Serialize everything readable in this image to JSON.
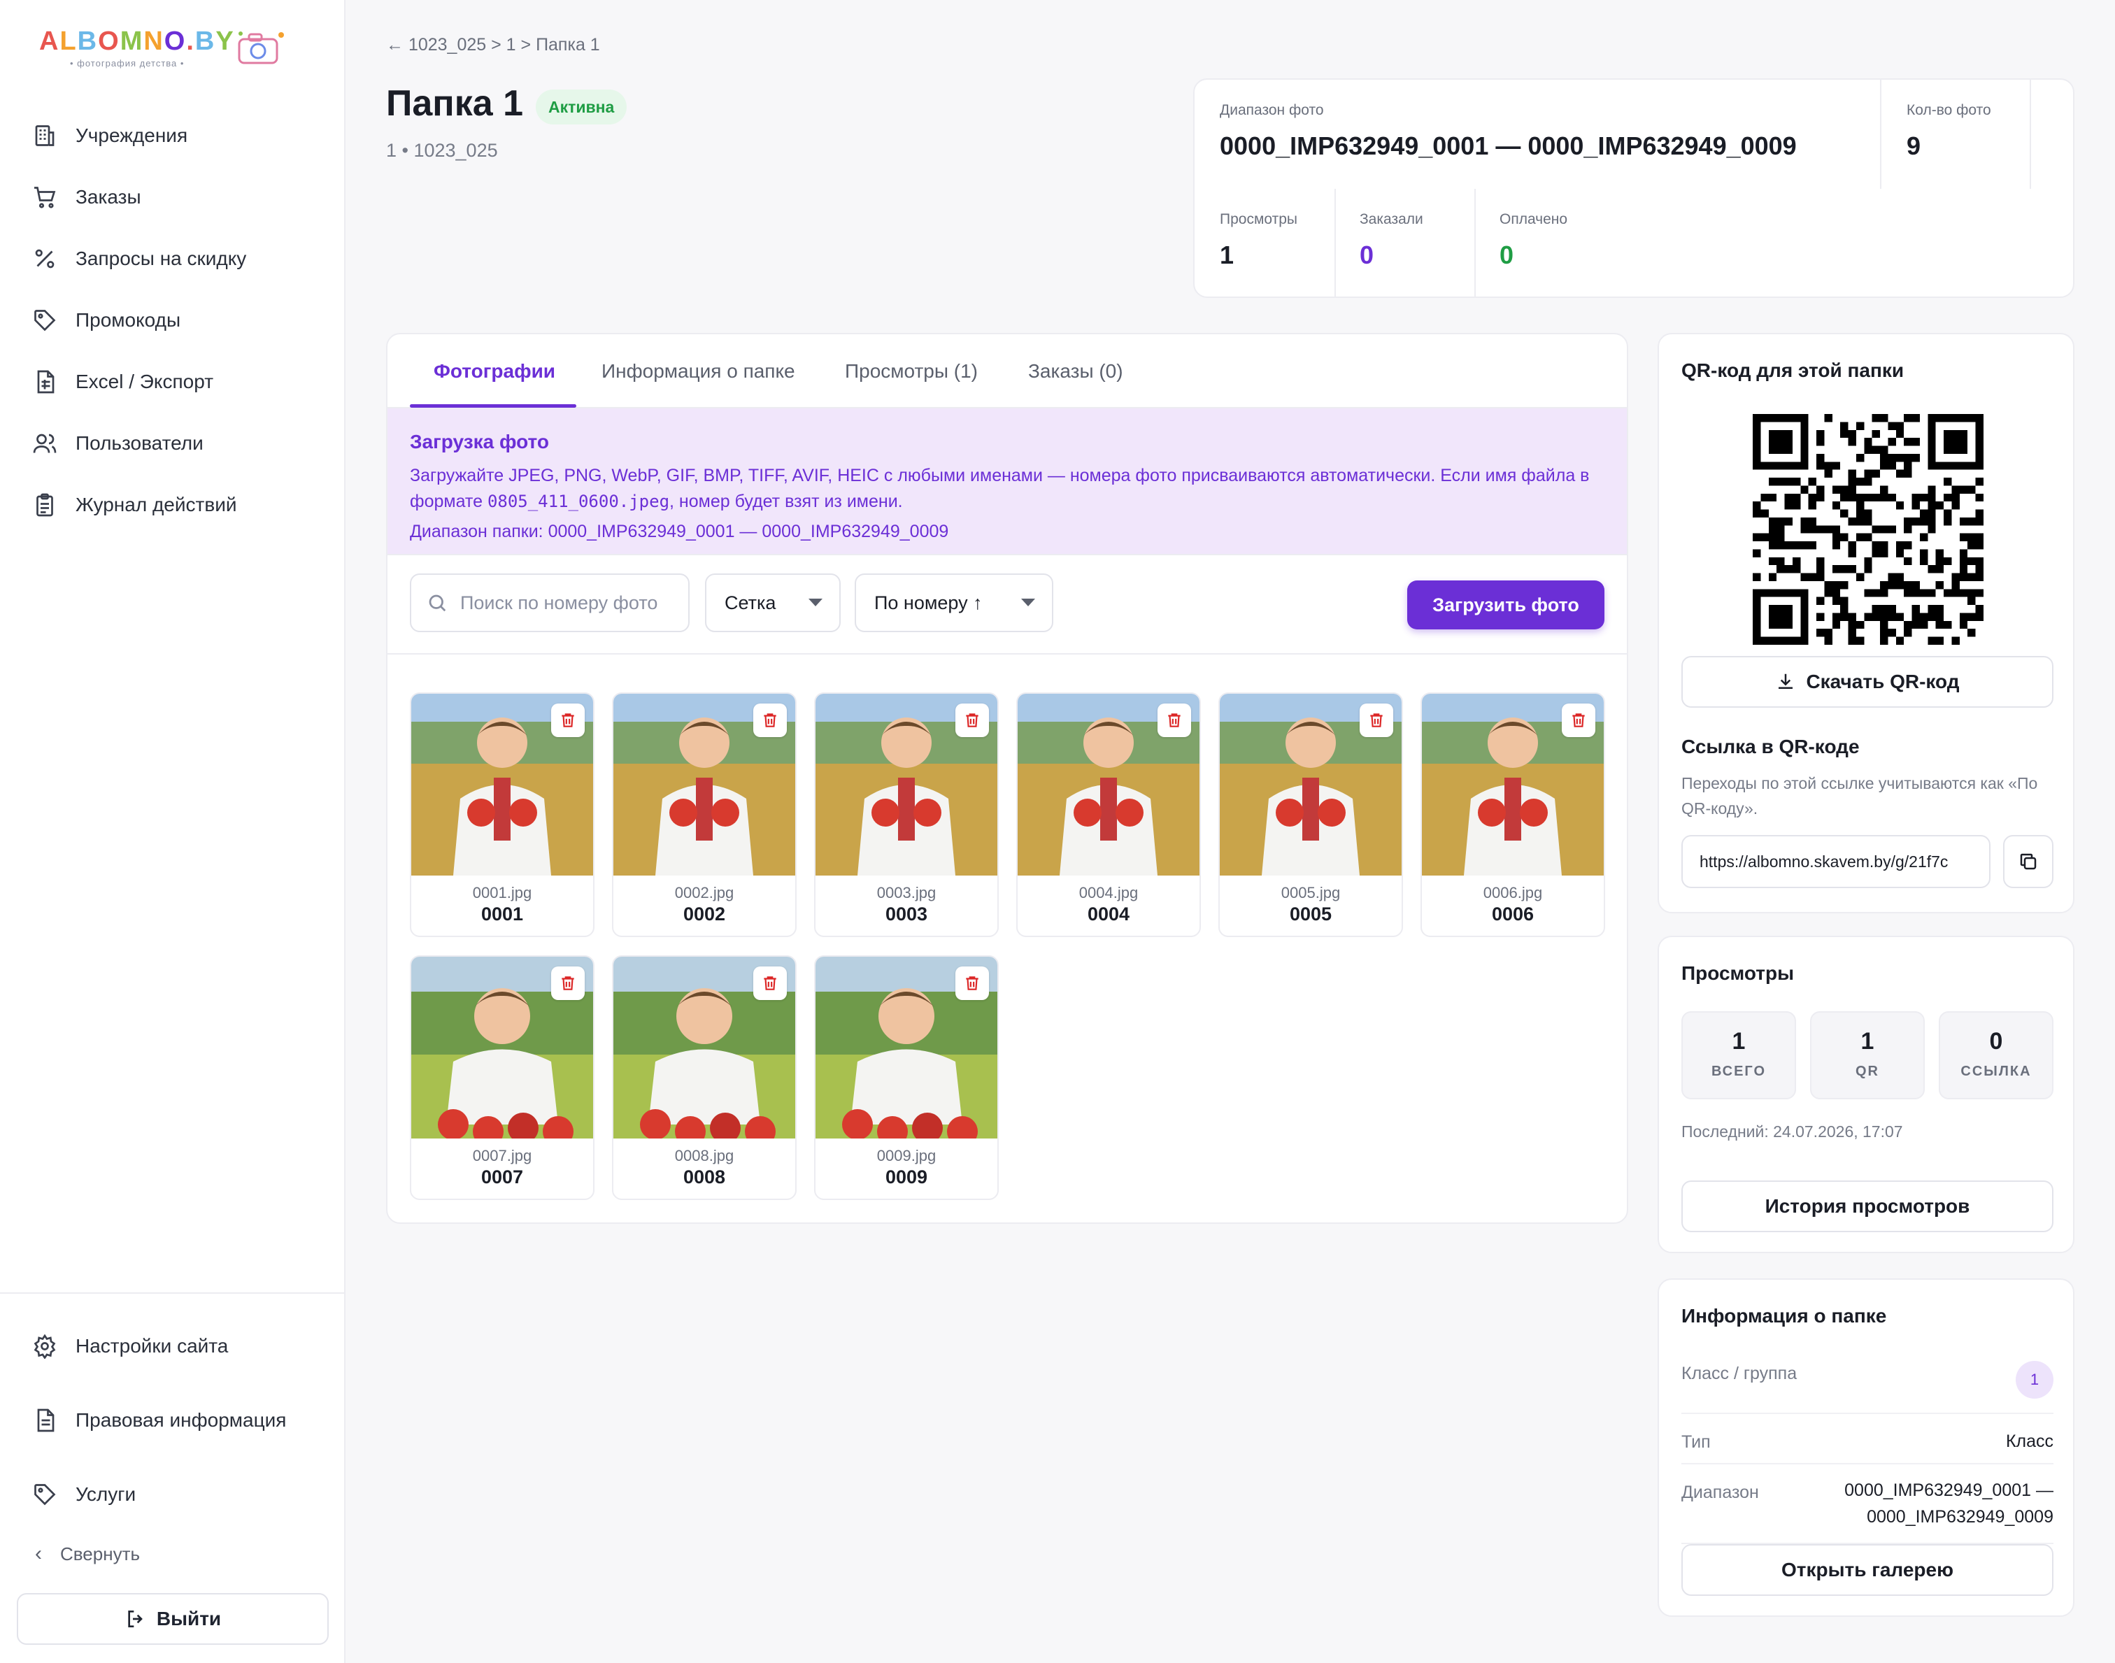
{
  "logo": {
    "text": "ALBOMNO.BY",
    "subtitle": "• фотография детства •"
  },
  "sidebar": {
    "items": [
      {
        "label": "Учреждения",
        "icon": "building-icon"
      },
      {
        "label": "Заказы",
        "icon": "cart-icon"
      },
      {
        "label": "Запросы на скидку",
        "icon": "percent-icon"
      },
      {
        "label": "Промокоды",
        "icon": "tag-icon"
      },
      {
        "label": "Excel / Экспорт",
        "icon": "spreadsheet-icon"
      },
      {
        "label": "Пользователи",
        "icon": "users-icon"
      },
      {
        "label": "Журнал действий",
        "icon": "clipboard-icon"
      }
    ],
    "bottom_items": [
      {
        "label": "Настройки сайта",
        "icon": "gear-icon"
      },
      {
        "label": "Правовая информация",
        "icon": "document-icon"
      },
      {
        "label": "Услуги",
        "icon": "tag-icon"
      }
    ],
    "collapse_label": "Свернуть",
    "logout_label": "Выйти"
  },
  "header": {
    "breadcrumb": "← 1023_025 > 1 > Папка 1",
    "title": "Папка 1",
    "status": "Активна",
    "subtitle": "1 • 1023_025"
  },
  "stats": {
    "range_label": "Диапазон фото",
    "range_value": "0000_IMP632949_0001 — 0000_IMP632949_0009",
    "count_label": "Кол-во фото",
    "count_value": "9",
    "views_label": "Просмотры",
    "views_value": "1",
    "ordered_label": "Заказали",
    "ordered_value": "0",
    "paid_label": "Оплачено",
    "paid_value": "0"
  },
  "tabs": [
    {
      "label": "Фотографии",
      "active": true
    },
    {
      "label": "Информация о папке",
      "active": false
    },
    {
      "label": "Просмотры (1)",
      "active": false
    },
    {
      "label": "Заказы (0)",
      "active": false
    }
  ],
  "upload_info": {
    "title": "Загрузка фото",
    "text_before": "Загружайте JPEG, PNG, WebP, GIF, BMP, TIFF, AVIF, HEIC с любыми именами — номера фото присваиваются автоматически. Если имя файла в формате ",
    "code": "0805_411_0600.jpeg",
    "text_after": ", номер будет взят из имени.",
    "range": "Диапазон папки: 0000_IMP632949_0001 — 0000_IMP632949_0009"
  },
  "toolbar": {
    "search_placeholder": "Поиск по номеру фото",
    "view_select": "Сетка",
    "sort_select": "По номеру ↑",
    "upload_label": "Загрузить фото"
  },
  "photos": [
    {
      "file": "0001.jpg",
      "num": "0001"
    },
    {
      "file": "0002.jpg",
      "num": "0002"
    },
    {
      "file": "0003.jpg",
      "num": "0003"
    },
    {
      "file": "0004.jpg",
      "num": "0004"
    },
    {
      "file": "0005.jpg",
      "num": "0005"
    },
    {
      "file": "0006.jpg",
      "num": "0006"
    },
    {
      "file": "0007.jpg",
      "num": "0007"
    },
    {
      "file": "0008.jpg",
      "num": "0008"
    },
    {
      "file": "0009.jpg",
      "num": "0009"
    }
  ],
  "qr_card": {
    "title": "QR-код для этой папки",
    "download_label": "Скачать QR-код",
    "link_title": "Ссылка в QR-коде",
    "link_note": "Переходы по этой ссылке учитываются как «По QR-коду».",
    "link_value": "https://albomno.skavem.by/g/21f7c"
  },
  "views_card": {
    "title": "Просмотры",
    "total": "1",
    "total_label": "ВСЕГО",
    "qr": "1",
    "qr_label": "QR",
    "link": "0",
    "link_label": "ССЫЛКА",
    "last": "Последний: 24.07.2026, 17:07",
    "history_label": "История просмотров"
  },
  "folder_info": {
    "title": "Информация о папке",
    "class_label": "Класс / группа",
    "class_value": "1",
    "type_label": "Тип",
    "type_value": "Класс",
    "range_label": "Диапазон",
    "range_line1": "0000_IMP632949_0001 —",
    "range_line2": "0000_IMP632949_0009",
    "open_label": "Открыть галерею"
  },
  "colors": {
    "accent": "#6b2fd6",
    "success": "#1f9d44",
    "danger": "#dc2626"
  }
}
